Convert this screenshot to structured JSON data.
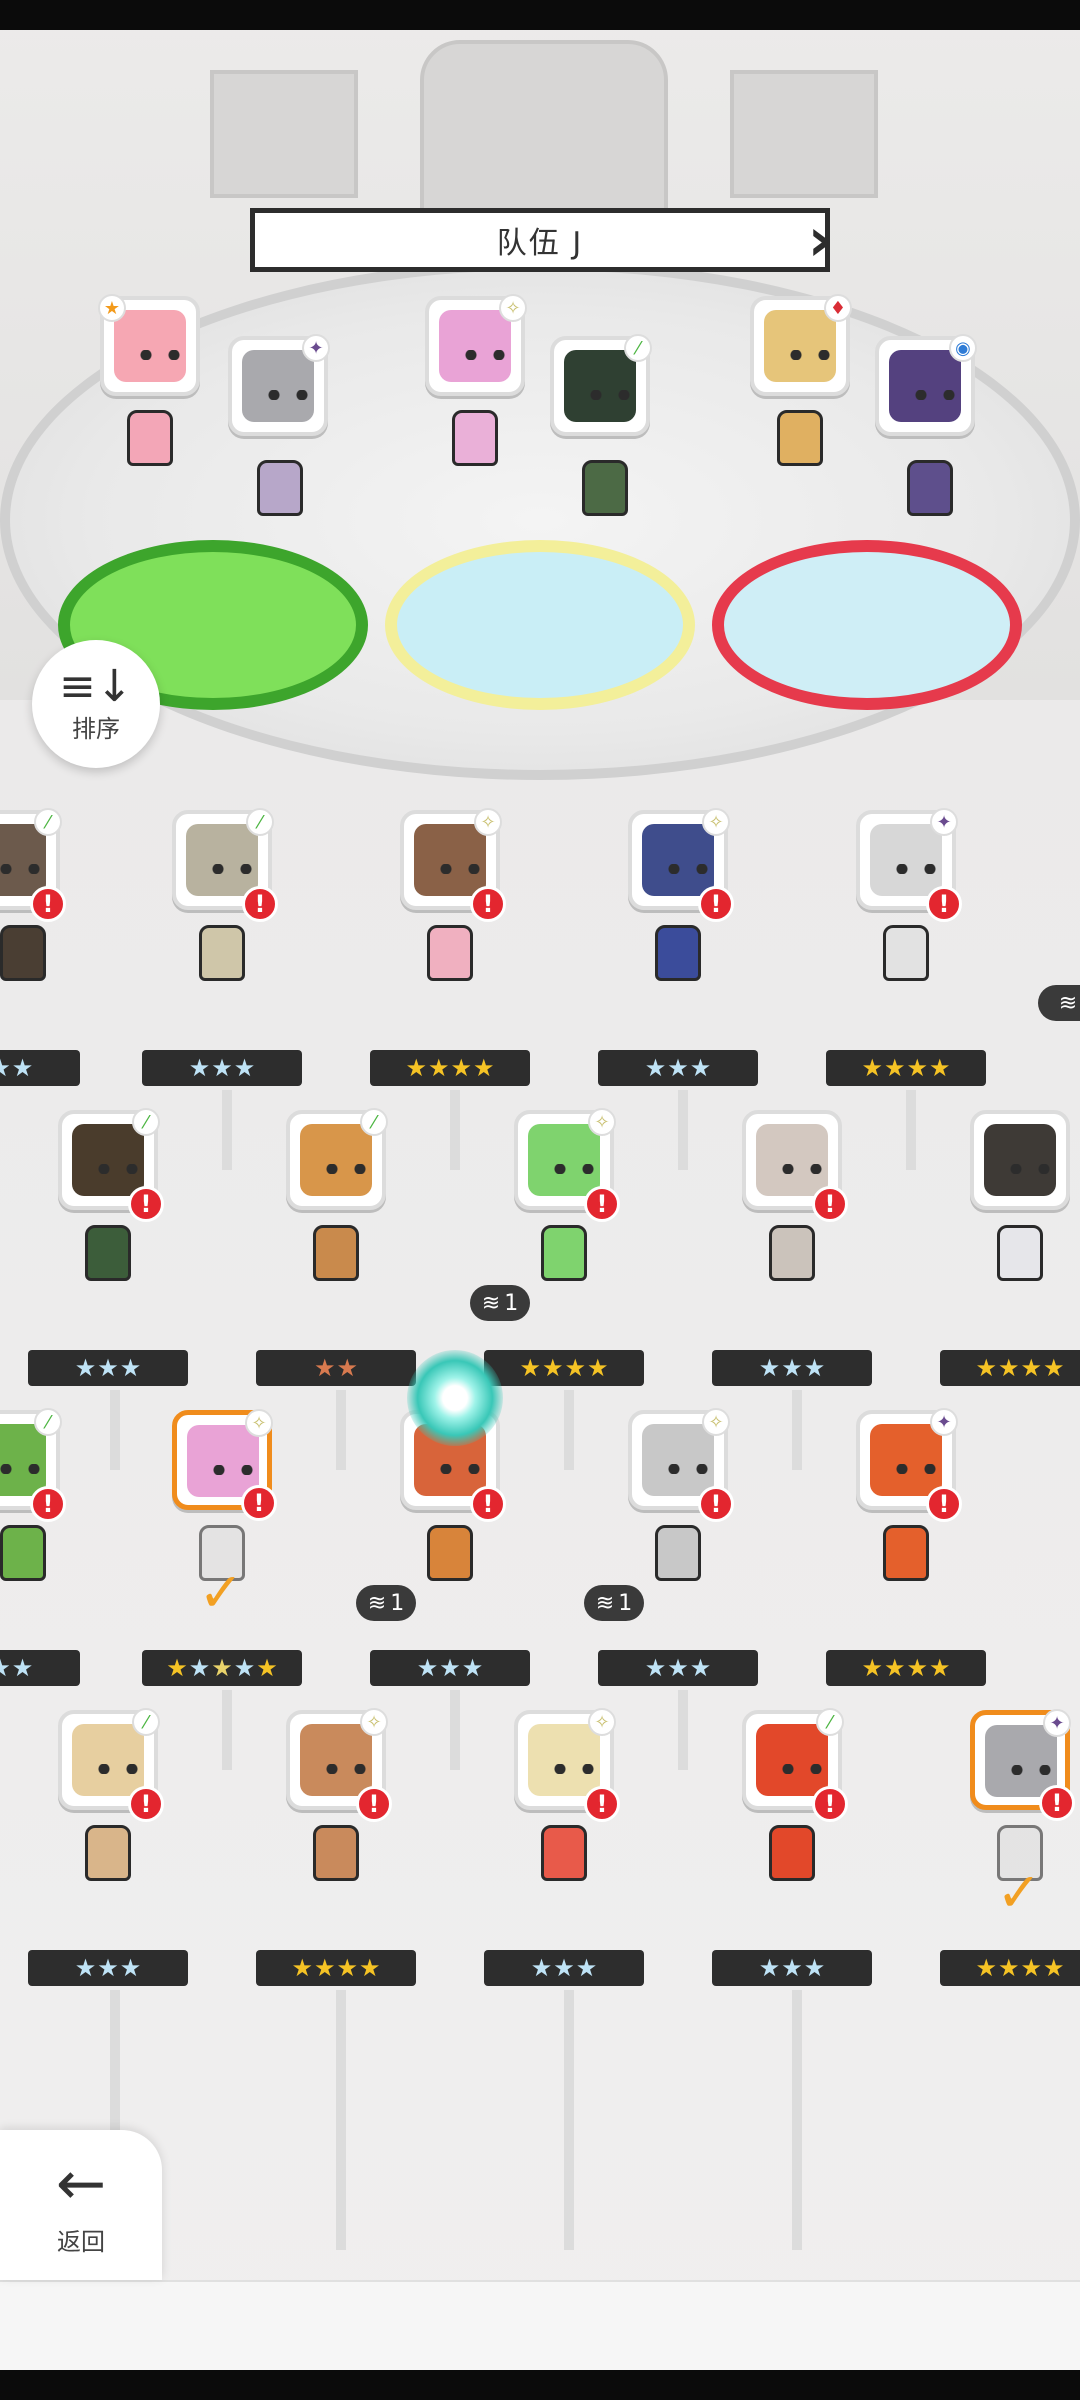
{
  "team": {
    "name": "队伍 J"
  },
  "buttons": {
    "sort_label": "排序",
    "back_label": "返回"
  },
  "colors": {
    "accent": "#f08c1c",
    "alert": "#e3262f",
    "star_gold": "#f5c325",
    "star_blue": "#bfe3f6",
    "plate": "#2d2d2d"
  },
  "duplicate_counts": [
    "1",
    "1",
    "1"
  ]
}
